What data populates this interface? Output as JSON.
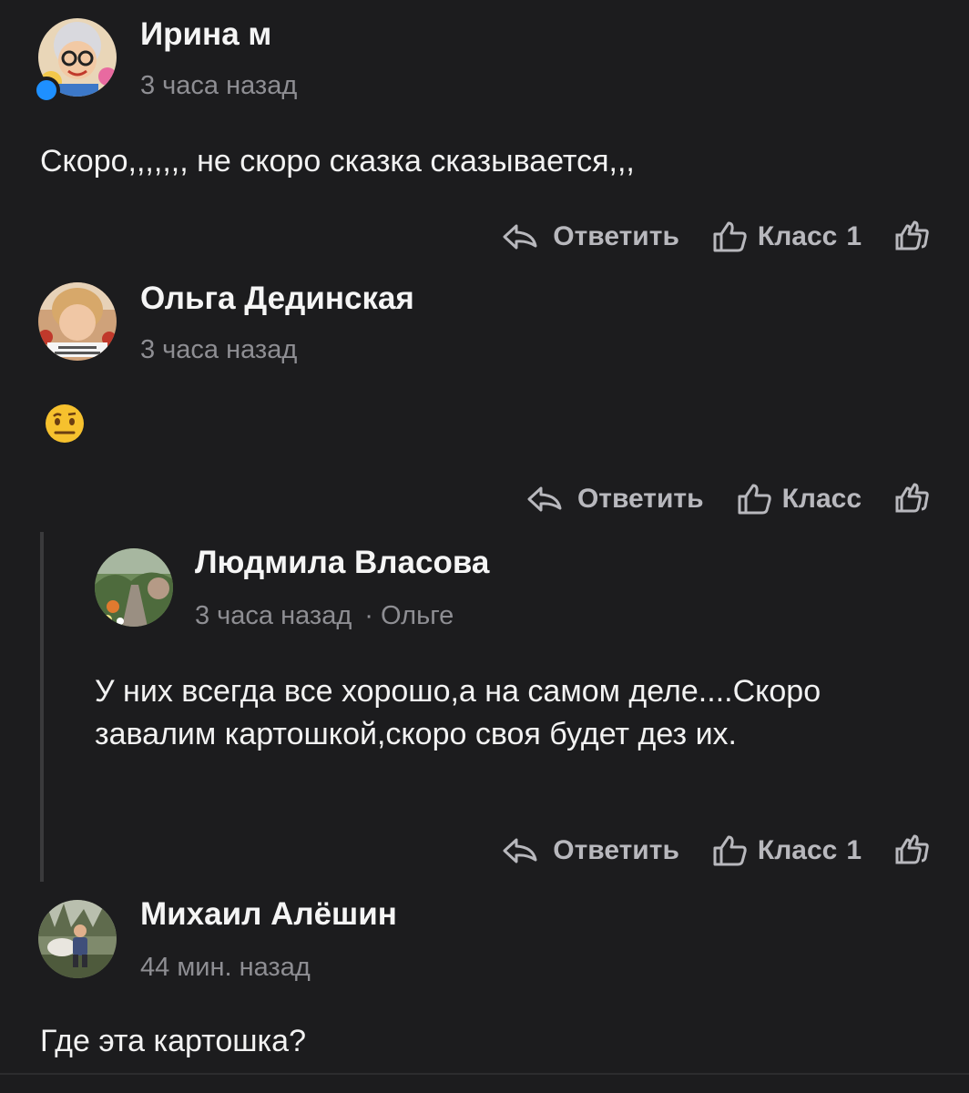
{
  "comments": [
    {
      "author": "Ирина м",
      "time": "3 часа назад",
      "text": "Скоро,,,,,,, не скоро сказка сказывается,,,",
      "reply_label": "Ответить",
      "like_label": "Класс",
      "like_count": "1"
    },
    {
      "author": "Ольга Дединская",
      "time": "3 часа назад",
      "text": "",
      "emoji_icon": "raised-eyebrow-face-icon",
      "reply_label": "Ответить",
      "like_label": "Класс",
      "like_count": ""
    },
    {
      "author": "Людмила Власова",
      "time": "3 часа назад",
      "reply_to": "Ольге",
      "text": "У них всегда все хорошо,а на самом деле....Скоро завалим картошкой,скоро своя будет дез их.",
      "reply_label": "Ответить",
      "like_label": "Класс",
      "like_count": "1"
    },
    {
      "author": "Михаил Алёшин",
      "time": "44 мин. назад",
      "text": "Где эта картошка?"
    }
  ],
  "colors": {
    "background": "#1c1c1e",
    "muted": "#8e8e93",
    "action": "#b8b8bd",
    "online": "#1e90ff"
  }
}
